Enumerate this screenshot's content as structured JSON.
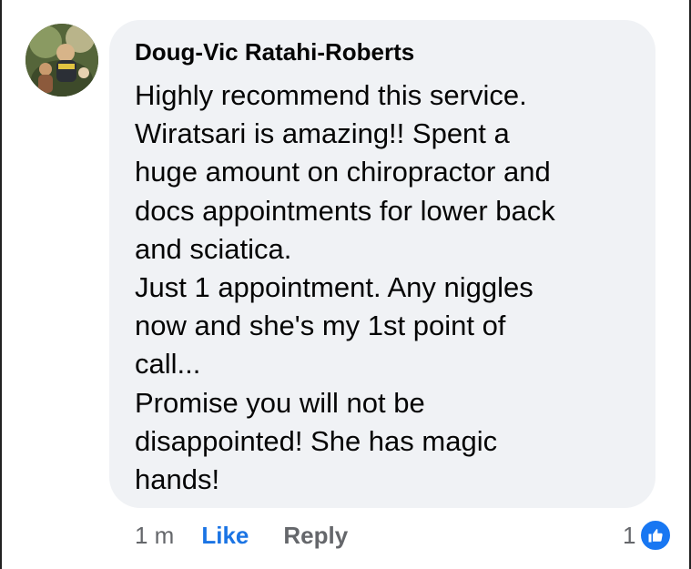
{
  "comment": {
    "author": "Doug-Vic Ratahi-Roberts",
    "text_lines": [
      "Highly recommend this service.",
      "Wiratsari is amazing!!  Spent a",
      "huge amount on chiropractor and",
      "docs appointments for lower back",
      "and sciatica.",
      "Just 1 appointment. Any niggles",
      "now and she's my 1st point of",
      "call...",
      "Promise you will not be",
      "disappointed! She has magic",
      "hands!"
    ],
    "bubble_color": "#f0f2f5"
  },
  "actions": {
    "timestamp": "1 m",
    "like_label": "Like",
    "reply_label": "Reply",
    "like_color": "#1b74e4"
  },
  "reactions": {
    "count": "1",
    "icon": "thumbs-up-icon",
    "icon_color": "#1877f2"
  },
  "avatar": {
    "icon": "profile-photo"
  }
}
